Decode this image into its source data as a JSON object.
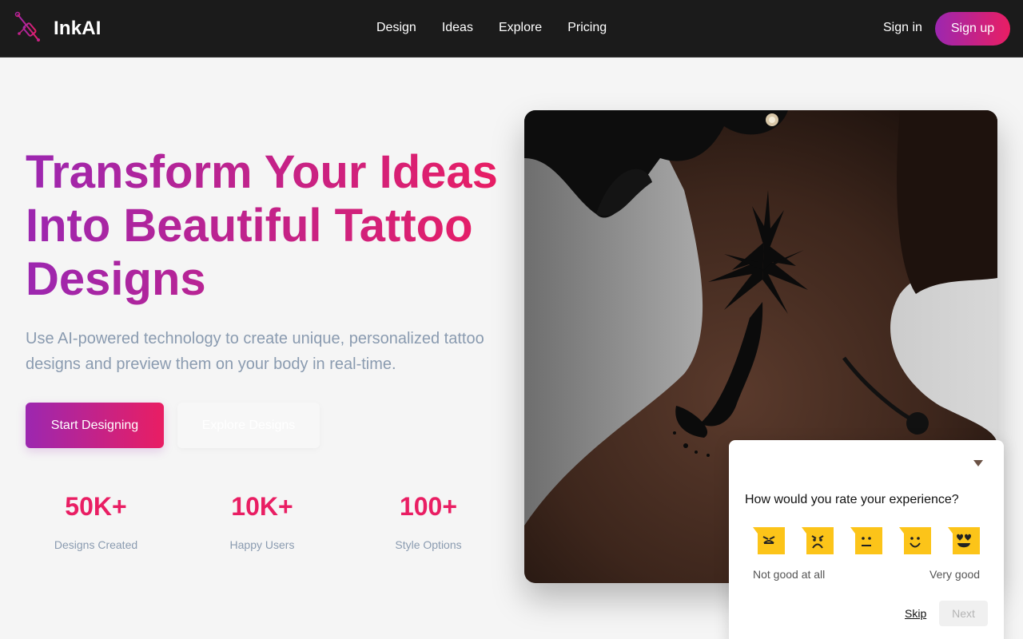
{
  "nav": {
    "brand": "InkAI",
    "links": [
      "Design",
      "Ideas",
      "Explore",
      "Pricing"
    ],
    "sign_in": "Sign in",
    "sign_up": "Sign up"
  },
  "hero": {
    "title_lines": [
      "Transform Your Ideas",
      "Into Beautiful Tattoo",
      "Designs"
    ],
    "subtitle": "Use AI-powered technology to create unique, personalized tattoo designs and preview them on your body in real-time.",
    "primary_button": "Start Designing",
    "secondary_button": "Explore Designs"
  },
  "stats": [
    {
      "value": "50K+",
      "label": "Designs Created"
    },
    {
      "value": "10K+",
      "label": "Happy Users"
    },
    {
      "value": "100+",
      "label": "Style Options"
    }
  ],
  "survey": {
    "question": "How would you rate your experience?",
    "scale_left": "Not good at all",
    "scale_right": "Very good",
    "skip": "Skip",
    "next": "Next",
    "options": [
      "angry-face-icon",
      "sad-face-icon",
      "neutral-face-icon",
      "smile-face-icon",
      "heart-eyes-face-icon"
    ]
  },
  "colors": {
    "accent_start": "#9c27b0",
    "accent_end": "#e91e63",
    "nav_bg": "#1b1b1b",
    "emoji_yellow": "#fcc419"
  }
}
